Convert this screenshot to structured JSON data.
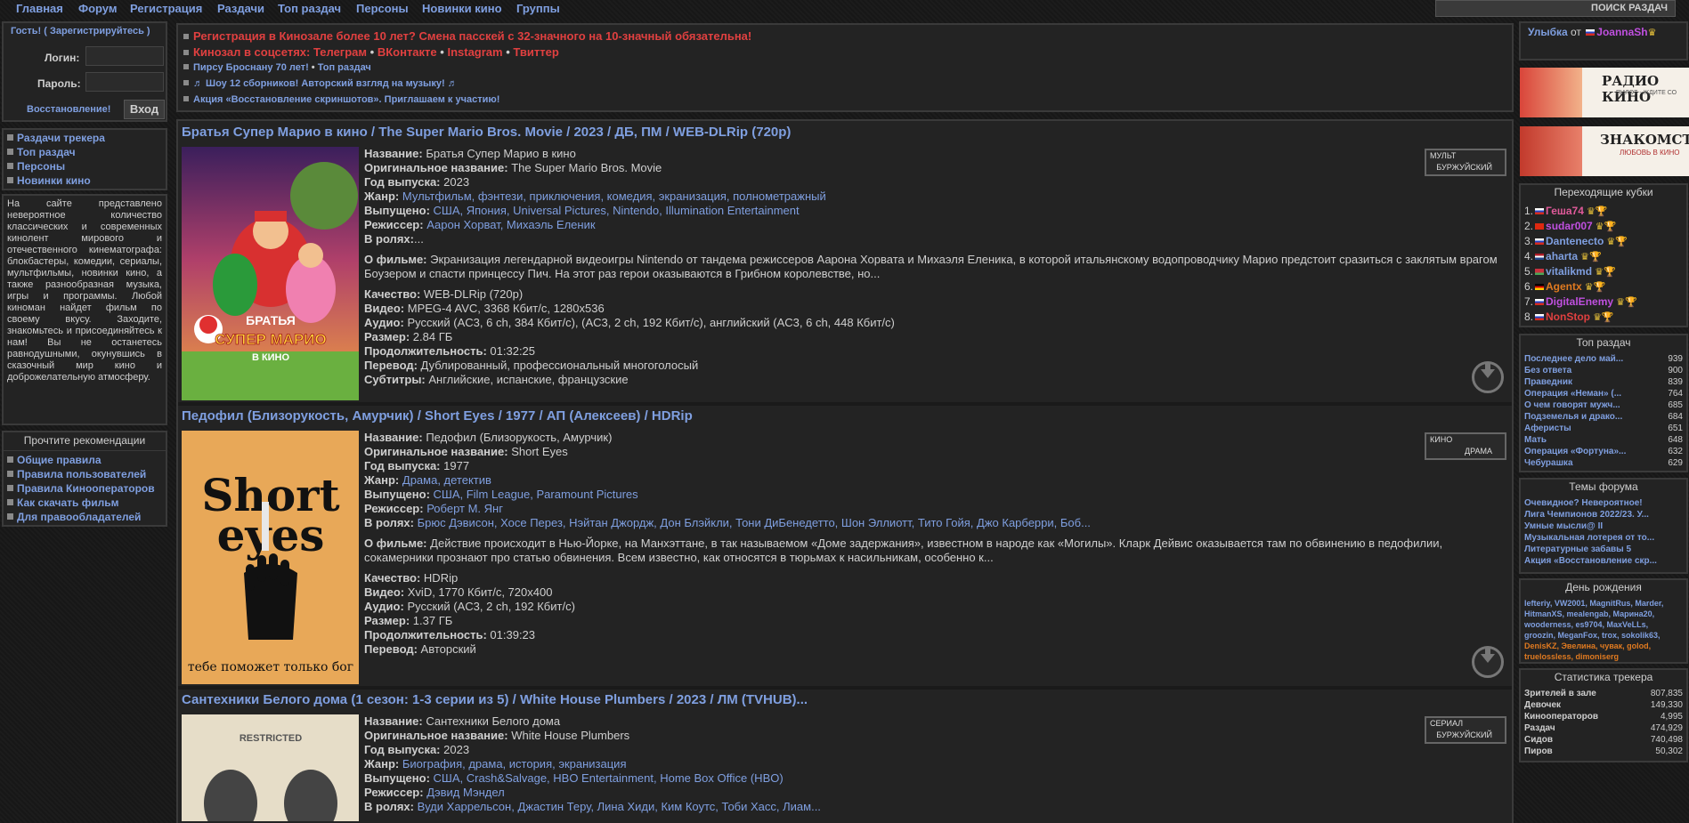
{
  "nav": {
    "items": [
      "Главная",
      "Форум",
      "Регистрация",
      "Раздачи",
      "Топ раздач",
      "Персоны",
      "Новинки кино",
      "Группы"
    ],
    "search_button": "ПОИСК РАЗДАЧ"
  },
  "login": {
    "guest_text": "Гость! ( Зарегистрируйтесь )",
    "login_label": "Логин:",
    "password_label": "Пароль:",
    "restore_link": "Восстановление!",
    "enter_button": "Вход"
  },
  "left_links": [
    "Раздачи трекера",
    "Топ раздач",
    "Персоны",
    "Новинки кино"
  ],
  "about_text": "На сайте представлено невероятное количество классических и современных кинолент мирового и отечественного кинематографа: блокбастеры, комедии, сериалы, мультфильмы, новинки кино, а также разнообразная музыка, игры и программы. Любой киноман найдет фильм по своему вкусу. Заходите, знакомьтесь и присоединяйтесь к нам! Вы не останетесь равнодушными, окунувшись в сказочный мир кино и доброжелательную атмосферу.",
  "rules": {
    "title": "Прочтите рекомендации",
    "items": [
      "Общие правила",
      "Правила пользователей",
      "Правила Кинооператоров",
      "Как скачать фильм",
      "Для правообладателей"
    ]
  },
  "news": {
    "line1": "Регистрация в Кинозале более 10 лет? Смена пасскей с 32-значного на 10-значный обязательна!",
    "line2_prefix": "Кинозал в соцсетях:",
    "line2_items": [
      "Телеграм",
      "ВКонтакте",
      "Instagram",
      "Твиттер"
    ],
    "line2_sep": "•",
    "line3_a": "Пирсу Броснану 70 лет!",
    "line3_b": "Топ раздач",
    "line4": "♬ Шоу 12 сборников! Авторский взгляд на музыку! ♬",
    "line5": "Акция «Восстановление скриншотов». Приглашаем к участию!"
  },
  "labels": {
    "name": "Название:",
    "orig": "Оригинальное название:",
    "year": "Год выпуска:",
    "genre": "Жанр:",
    "made": "Выпущено:",
    "director": "Режиссер:",
    "cast": "В ролях:",
    "about": "О фильме:",
    "quality": "Качество:",
    "video": "Видео:",
    "audio": "Аудио:",
    "size": "Размер:",
    "duration": "Продолжительность:",
    "translation": "Перевод:",
    "subs": "Субтитры:"
  },
  "movies": [
    {
      "title": "Братья Супер Марио в кино / The Super Mario Bros. Movie / 2023 / ДБ, ПМ / WEB-DLRip (720p)",
      "name": "Братья Супер Марио в кино",
      "orig": "The Super Mario Bros. Movie",
      "year": "2023",
      "genre": "Мультфильм, фэнтези, приключения, комедия, экранизация, полнометражный",
      "made": "США, Япония, Universal Pictures, Nintendo, Illumination Entertainment",
      "director": "Аарон Хорват, Михаэль Еленик",
      "cast": "...",
      "about": "Экранизация легендарной видеоигры Nintendo от тандема режиссеров Аарона Хорвата и Михаэля Еленика, в которой итальянскому водопроводчику Марио предстоит сразиться с заклятым врагом Боузером и спасти принцессу Пич. На этот раз герои оказываются в Грибном королевстве, но...",
      "quality": "WEB-DLRip (720p)",
      "video": "MPEG-4 AVC, 3368 Кбит/с, 1280x536",
      "audio": "Русский (AC3, 6 ch, 384 Кбит/с), (AC3, 2 ch, 192 Кбит/с), английский (AC3, 6 ch, 448 Кбит/с)",
      "size": "2.84 ГБ",
      "duration": "01:32:25",
      "translation": "Дублированный, профессиональный многоголосый",
      "subs": "Английские, испанские, французские",
      "badge_top": "МУЛЬТ",
      "badge_bottom": "БУРЖУЙСКИЙ",
      "poster_text1": "БРАТЬЯ",
      "poster_text2": "СУПЕР МАРИО",
      "poster_text3": "В КИНО"
    },
    {
      "title": "Педофил (Близорукость, Амурчик) / Short Eyes / 1977 / АП (Алексеев) / HDRip",
      "name": "Педофил (Близорукость, Амурчик)",
      "orig": "Short Eyes",
      "year": "1977",
      "genre": "Драма, детектив",
      "made": "США, Film League, Paramount Pictures",
      "director": "Роберт М. Янг",
      "cast": "Брюс Дэвисон, Хосе Перез, Нэйтан Джордж, Дон Блэйкли, Тони ДиБенедетто, Шон Эллиотт, Тито Гойя, Джо Карберри, Боб...",
      "about": "Действие происходит в Нью-Йорке, на Манхэттане, в так называемом «Доме задержания», известном в народе как «Могилы». Кларк Дейвис оказывается там по обвинению в педофилии, сокамерники прознают про статью обвинения. Всем известно, как относятся в тюрьмах к насильникам, особенно к...",
      "quality": "HDRip",
      "video": "XviD, 1770 Кбит/с, 720x400",
      "audio": "Русский (AC3, 2 ch, 192 Кбит/с)",
      "size": "1.37 ГБ",
      "duration": "01:39:23",
      "translation": "Авторский",
      "badge_top": "КИНО",
      "badge_bottom": "ДРАМА",
      "poster_text1": "Short",
      "poster_text2": "eyes",
      "poster_text3": "тебе поможет только бог"
    },
    {
      "title": "Сантехники Белого дома (1 сезон: 1-3 серии из 5) / White House Plumbers / 2023 / ЛМ (TVHUB)...",
      "name": "Сантехники Белого дома",
      "orig": "White House Plumbers",
      "year": "2023",
      "genre": "Биография, драма, история, экранизация",
      "made": "США, Crash&Salvage, HBO Entertainment, Home Box Office (HBO)",
      "director": "Дэвид Мэндел",
      "cast": "Вуди Харрельсон, Джастин Теру, Лина Хиди, Ким Коутс, Тоби Хасс, Лиам...",
      "badge_top": "СЕРИАЛ",
      "badge_bottom": "БУРЖУЙСКИЙ",
      "poster_text1": "RESTRICTED"
    }
  ],
  "right": {
    "smile_text": "Улыбка",
    "smile_from": "от",
    "smile_user": "JoannaSh",
    "banner1_title": "РАДИО КИНО",
    "banner1_sub": "ПИЛОТ - ЖДИТЕ СО",
    "banner2_title": "ЗНАКОМСТ",
    "banner2_sub": "ЛЮБОВЬ В КИНО",
    "cups_title": "Переходящие кубки",
    "cups": [
      {
        "n": "1.",
        "name": "Геша74",
        "flag": "ru",
        "color": "#e05a9a"
      },
      {
        "n": "2.",
        "name": "sudar007",
        "flag": "cn",
        "color": "#c050e0"
      },
      {
        "n": "3.",
        "name": "Dantenecto",
        "flag": "ru",
        "color": "#7f9fe0"
      },
      {
        "n": "4.",
        "name": "aharta",
        "flag": "nl",
        "color": "#7f9fe0"
      },
      {
        "n": "5.",
        "name": "vitalikmd",
        "flag": "by",
        "color": "#7f9fe0"
      },
      {
        "n": "6.",
        "name": "Agentx",
        "flag": "de",
        "color": "#e07a20"
      },
      {
        "n": "7.",
        "name": "DigitalEnemy",
        "flag": "ru",
        "color": "#c050e0"
      },
      {
        "n": "8.",
        "name": "NonStop",
        "flag": "ru",
        "color": "#e04040"
      }
    ],
    "top_title": "Топ раздач",
    "top": [
      {
        "name": "Последнее дело май...",
        "num": "939"
      },
      {
        "name": "Без ответа",
        "num": "900"
      },
      {
        "name": "Праведник",
        "num": "839"
      },
      {
        "name": "Операция «Неман» (...",
        "num": "764"
      },
      {
        "name": "О чем говорят мужч...",
        "num": "685"
      },
      {
        "name": "Подземелья и драко...",
        "num": "684"
      },
      {
        "name": "Аферисты",
        "num": "651"
      },
      {
        "name": "Мать",
        "num": "648"
      },
      {
        "name": "Операция «Фортуна»...",
        "num": "632"
      },
      {
        "name": "Чебурашка",
        "num": "629"
      }
    ],
    "forum_title": "Темы форума",
    "forum": [
      "Очевидное? Невероятное!",
      "Лига Чемпионов 2022/23. У...",
      "Умные мысли@ II",
      "Музыкальная лотерея от то...",
      "Литературные забавы 5",
      "Акция «Восстановление скр..."
    ],
    "bday_title": "День рождения",
    "bday_lines": [
      "lefteriy, VW2001, MagnitRus, Marder,",
      "HitmanXS, mealengab, Марина20,",
      "wooderness, es9704, MaxVeLLs,",
      "groozin, MeganFox, trox, sokolik63,",
      "DenisKZ, Эвелина, чувак, golod,",
      "truelossless, dimoniserg"
    ],
    "stats_title": "Статистика трекера",
    "stats": [
      {
        "name": "Зрителей в зале",
        "num": "807,835"
      },
      {
        "name": "Девочек",
        "num": "149,330"
      },
      {
        "name": "Кинооператоров",
        "num": "4,995"
      },
      {
        "name": "Раздач",
        "num": "474,929"
      },
      {
        "name": "Сидов",
        "num": "740,498"
      },
      {
        "name": "Пиров",
        "num": "50,302"
      }
    ]
  }
}
